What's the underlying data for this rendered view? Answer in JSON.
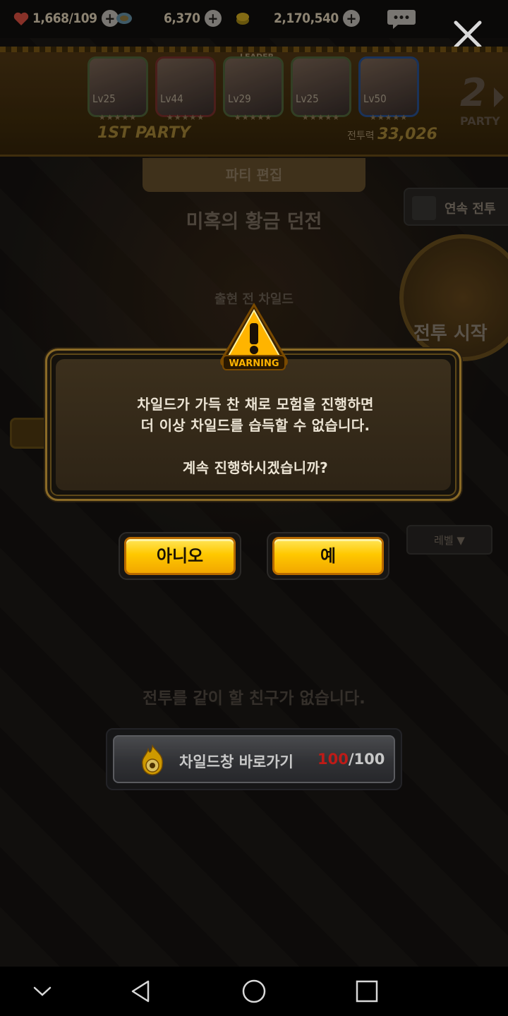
{
  "topbar": {
    "hearts": "1,668",
    "hearts_max": "/109",
    "gems": "6,370",
    "gold": "2,170,540"
  },
  "party": {
    "heroes": [
      {
        "level": "Lv25"
      },
      {
        "level": "Lv44"
      },
      {
        "level": "Lv29"
      },
      {
        "level": "Lv25"
      },
      {
        "level": "Lv50"
      }
    ],
    "leader_tag": "LEADER",
    "party_label": "1ST PARTY",
    "power_label": "전투력",
    "power_value": "33,026",
    "next_party_number": "2",
    "next_party_word": "PARTY"
  },
  "background": {
    "party_edit": "파티 편집",
    "dungeon_title": "미혹의 황금 던전",
    "auto_battle": "연속 전투",
    "child_before": "출현 전 차일드",
    "battle_start": "전투 시작",
    "level_sort": "레벨 ▼",
    "no_friends": "전투를 같이 할 친구가 없습니다."
  },
  "dialog": {
    "warning_label": "WARNING",
    "message_line1": "차일드가 가득 찬 채로 모험을 진행하면",
    "message_line2": "더 이상 차일드를 습득할 수 없습니다.",
    "message_line3": "계속 진행하시겠습니까?",
    "no_label": "아니오",
    "yes_label": "예"
  },
  "child_shortcut": {
    "label": "차일드창 바로가기",
    "current": "100",
    "max": "/100"
  },
  "colors": {
    "accent_yellow": "#ffc800",
    "count_red": "#e0201c",
    "dialog_border": "#8a6a26"
  }
}
